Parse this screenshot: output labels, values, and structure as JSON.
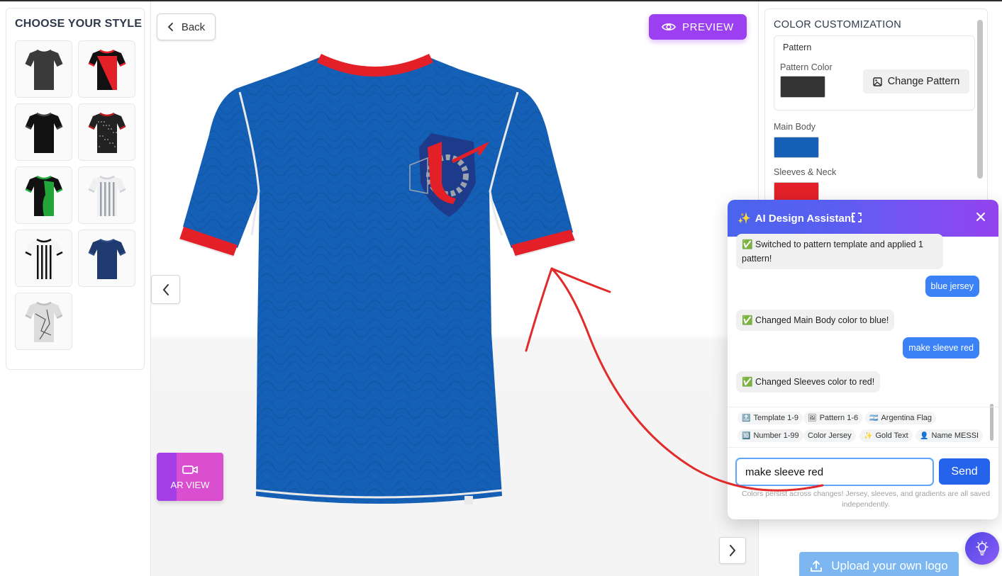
{
  "left_panel": {
    "title": "CHOOSE YOUR STYLE",
    "styles": [
      {
        "name": "style-dark-gray"
      },
      {
        "name": "style-red-black"
      },
      {
        "name": "style-black-gray"
      },
      {
        "name": "style-black-pattern"
      },
      {
        "name": "style-green-black"
      },
      {
        "name": "style-white-stripes"
      },
      {
        "name": "style-black-white-stripes"
      },
      {
        "name": "style-navy"
      },
      {
        "name": "style-gray-marble"
      }
    ]
  },
  "toolbar": {
    "back_label": "Back",
    "preview_label": "PREVIEW",
    "ar_label": "AR VIEW"
  },
  "jersey": {
    "main_body_color": "#1560b7",
    "sleeve_neck_color": "#e32027",
    "pattern_color": "#333333"
  },
  "color_customization": {
    "title": "COLOR CUSTOMIZATION",
    "pattern_label": "Pattern",
    "pattern_color_label": "Pattern Color",
    "change_pattern_label": "Change Pattern",
    "main_body_label": "Main Body",
    "sleeves_neck_label": "Sleeves & Neck"
  },
  "chat": {
    "title": "AI Design Assistant",
    "messages": [
      {
        "role": "bot",
        "text": "✅ Switched to pattern template and applied 1 pattern!"
      },
      {
        "role": "user",
        "text": "blue jersey"
      },
      {
        "role": "bot",
        "text": "✅ Changed Main Body color to blue!"
      },
      {
        "role": "user",
        "text": "make sleeve red"
      },
      {
        "role": "bot",
        "text": "✅ Changed Sleeves color to red!"
      }
    ],
    "chips": [
      {
        "icon": "🔝",
        "label": "Template 1-9"
      },
      {
        "icon": "🖼",
        "label": "Pattern 1-6"
      },
      {
        "icon": "🇦🇷",
        "label": "Argentina Flag"
      },
      {
        "icon": "🔟",
        "label": "Number 1-99"
      },
      {
        "icon": "",
        "label": "Color Jersey"
      },
      {
        "icon": "✨",
        "label": "Gold Text"
      },
      {
        "icon": "👤",
        "label": "Name MESSI"
      }
    ],
    "input_value": "make sleeve red",
    "send_label": "Send",
    "hint": "Colors persist across changes! Jersey, sleeves, and gradients are all saved independently."
  },
  "upload_label": "Upload your own logo"
}
